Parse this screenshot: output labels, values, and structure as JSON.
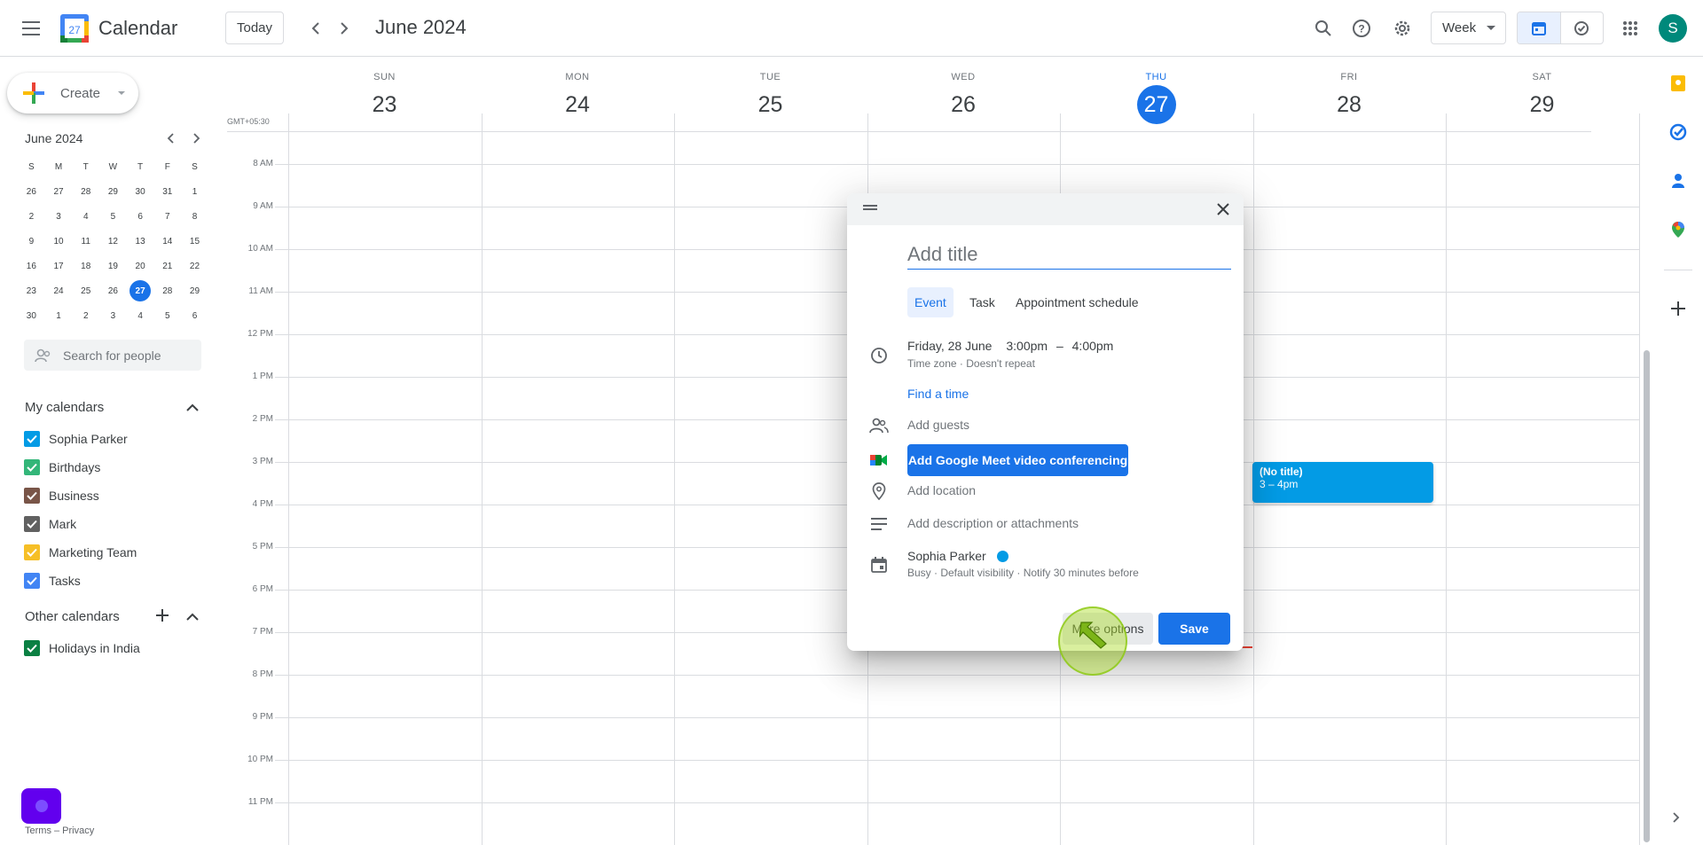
{
  "header": {
    "app_name": "Calendar",
    "logo_day": "27",
    "today_label": "Today",
    "month_title": "June 2024",
    "view_label": "Week",
    "avatar_initial": "S"
  },
  "sidebar": {
    "create_label": "Create",
    "mini_cal": {
      "title": "June 2024",
      "weekdays": [
        "S",
        "M",
        "T",
        "W",
        "T",
        "F",
        "S"
      ],
      "weeks": [
        [
          "26",
          "27",
          "28",
          "29",
          "30",
          "31",
          "1"
        ],
        [
          "2",
          "3",
          "4",
          "5",
          "6",
          "7",
          "8"
        ],
        [
          "9",
          "10",
          "11",
          "12",
          "13",
          "14",
          "15"
        ],
        [
          "16",
          "17",
          "18",
          "19",
          "20",
          "21",
          "22"
        ],
        [
          "23",
          "24",
          "25",
          "26",
          "27",
          "28",
          "29"
        ],
        [
          "30",
          "1",
          "2",
          "3",
          "4",
          "5",
          "6"
        ]
      ],
      "selected": "27"
    },
    "people_search_placeholder": "Search for people",
    "my_calendars_title": "My calendars",
    "my_calendars": [
      {
        "label": "Sophia Parker",
        "color": "#039be5"
      },
      {
        "label": "Birthdays",
        "color": "#33b679"
      },
      {
        "label": "Business",
        "color": "#795548"
      },
      {
        "label": "Mark",
        "color": "#616161"
      },
      {
        "label": "Marketing Team",
        "color": "#f6bf26"
      },
      {
        "label": "Tasks",
        "color": "#4285f4"
      }
    ],
    "other_calendars_title": "Other calendars",
    "other_calendars": [
      {
        "label": "Holidays in India",
        "color": "#0b8043"
      }
    ],
    "footer": "Terms – Privacy"
  },
  "grid": {
    "timezone": "GMT+05:30",
    "days": [
      {
        "dow": "SUN",
        "num": "23"
      },
      {
        "dow": "MON",
        "num": "24"
      },
      {
        "dow": "TUE",
        "num": "25"
      },
      {
        "dow": "WED",
        "num": "26"
      },
      {
        "dow": "THU",
        "num": "27"
      },
      {
        "dow": "FRI",
        "num": "28"
      },
      {
        "dow": "SAT",
        "num": "29"
      }
    ],
    "hours": [
      "8 AM",
      "9 AM",
      "10 AM",
      "11 AM",
      "12 PM",
      "1 PM",
      "2 PM",
      "3 PM",
      "4 PM",
      "5 PM",
      "6 PM",
      "7 PM",
      "8 PM",
      "9 PM",
      "10 PM",
      "11 PM"
    ]
  },
  "event": {
    "title": "(No title)",
    "time": "3 – 4pm"
  },
  "dialog": {
    "title_placeholder": "Add title",
    "tabs": [
      "Event",
      "Task",
      "Appointment schedule"
    ],
    "active_tab": "Event",
    "date": "Friday, 28 June",
    "start": "3:00pm",
    "dash": "–",
    "end": "4:00pm",
    "timezone_line": "Time zone · Doesn't repeat",
    "find_time": "Find a time",
    "add_guests": "Add guests",
    "meet_label": "Add Google Meet video conferencing",
    "add_location": "Add location",
    "add_description": "Add description or attachments",
    "calendar_owner": "Sophia Parker",
    "calendar_meta": "Busy · Default visibility · Notify 30 minutes before",
    "more_options": "More options",
    "save": "Save"
  },
  "colors": {
    "accent": "#1a73e8",
    "event": "#039be5"
  }
}
